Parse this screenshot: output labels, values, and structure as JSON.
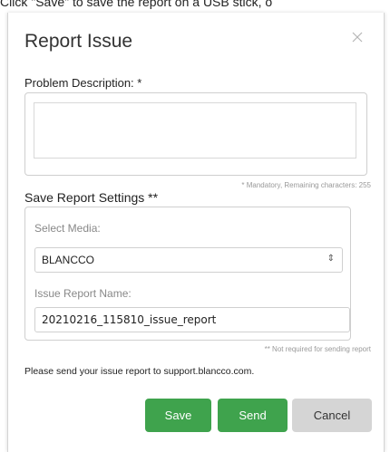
{
  "instruction": "Click \"Save\" to save the report on a USB stick, o",
  "dialog": {
    "title": "Report Issue",
    "close_icon": "close-icon"
  },
  "problem": {
    "label": "Problem Description: *",
    "value": "",
    "note": "* Mandatory, Remaining characters: 255"
  },
  "settings": {
    "label": "Save Report Settings **",
    "select_media_label": "Select Media:",
    "select_media_value": "BLANCCO",
    "issue_name_label": "Issue Report Name:",
    "issue_name_value": "20210216_115810_issue_report",
    "note": "** Not required for sending report"
  },
  "send_info": "Please send your issue report to support.blancco.com.",
  "buttons": {
    "save": "Save",
    "send": "Send",
    "cancel": "Cancel"
  },
  "colors": {
    "primary_green": "#3fa34d",
    "cancel_gray": "#d5d5d5"
  }
}
